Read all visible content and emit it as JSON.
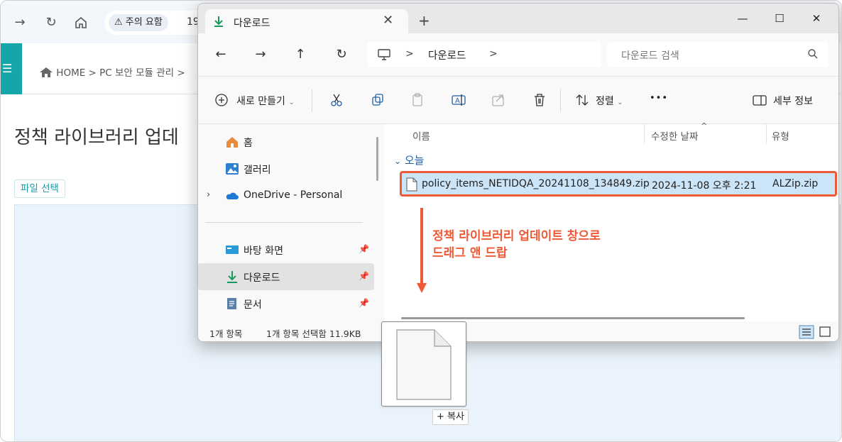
{
  "browser": {
    "warning_label": "주의 요함",
    "address_partial": "19",
    "breadcrumb": "HOME > PC 보안 모듈 관리 >",
    "page_title": "정책 라이브러리 업데",
    "file_select_button": "파일 선택",
    "accent_color": "#14a6a9"
  },
  "explorer": {
    "tab_title": "다운로드",
    "tab_close": "✕",
    "new_tab": "+",
    "window_controls": {
      "minimize": "—",
      "maximize": "☐",
      "close": "✕"
    },
    "path": {
      "separator": ">",
      "folder": "다운로드"
    },
    "search_placeholder": "다운로드 검색",
    "toolbar": {
      "new_label": "새로 만들기",
      "sort_label": "정렬",
      "more": "•••",
      "details_label": "세부 정보"
    },
    "nav_items": [
      {
        "label": "홈",
        "icon": "home-icon"
      },
      {
        "label": "갤러리",
        "icon": "gallery-icon"
      },
      {
        "label": "OneDrive - Personal",
        "icon": "cloud-icon"
      },
      {
        "label": "바탕 화면",
        "icon": "desktop-icon"
      },
      {
        "label": "다운로드",
        "icon": "download-icon"
      },
      {
        "label": "문서",
        "icon": "document-icon"
      }
    ],
    "columns": {
      "name": "이름",
      "date": "수정한 날짜",
      "type": "유형"
    },
    "group_label": "오늘",
    "file": {
      "name": "policy_items_NETIDQA_20241108_134849.zip",
      "date": "2024-11-08 오후 2:21",
      "type": "ALZip.zip"
    },
    "annotation": [
      "정책 라이브러리 업데이트 창으로",
      "드래그 앤 드랍"
    ],
    "annotation_color": "#ef5a35",
    "status": {
      "count": "1개 항목",
      "selected": "1개 항목 선택함 11.9KB"
    }
  },
  "drag": {
    "copy_label": "+ 복사"
  }
}
